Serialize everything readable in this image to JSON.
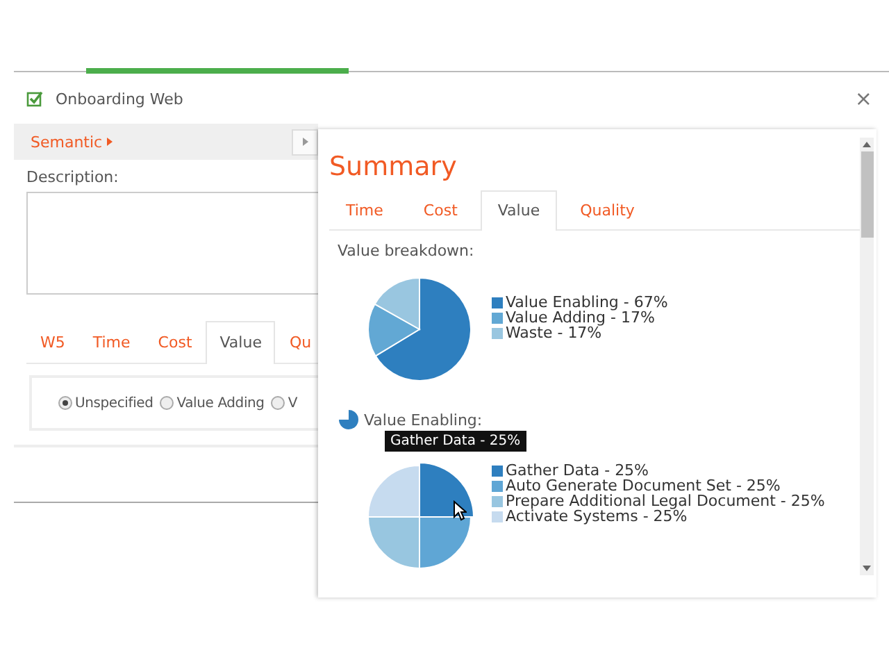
{
  "indicator": {
    "on": true
  },
  "header": {
    "title": "Onboarding Web",
    "checked": true,
    "close": "×"
  },
  "semantic": {
    "label": "Semantic"
  },
  "description": {
    "label": "Description:"
  },
  "tabs": [
    {
      "label": "W5",
      "selected": false
    },
    {
      "label": "Time",
      "selected": false
    },
    {
      "label": "Cost",
      "selected": false
    },
    {
      "label": "Value",
      "selected": true
    },
    {
      "label": "Qu",
      "selected": false
    }
  ],
  "value_options": [
    {
      "label": "Unspecified",
      "selected": true
    },
    {
      "label": "Value Adding",
      "selected": false
    },
    {
      "label": "V",
      "selected": false
    }
  ],
  "summary": {
    "title": "Summary",
    "tabs": [
      {
        "label": "Time",
        "selected": false
      },
      {
        "label": "Cost",
        "selected": false
      },
      {
        "label": "Value",
        "selected": true
      },
      {
        "label": "Quality",
        "selected": false
      }
    ],
    "sections": [
      {
        "label": "Value breakdown:",
        "chart_data": {
          "type": "pie",
          "categories": [
            "Value Enabling - 67%",
            "Value Adding - 17%",
            "Waste - 17%"
          ],
          "values": [
            67,
            17,
            17
          ],
          "legend": "right",
          "colors": [
            "#2e7fbf",
            "#62a8d4",
            "#99c6e0"
          ]
        }
      },
      {
        "label": "Value Enabling:",
        "tooltip": "Gather Data - 25%",
        "chart_data": {
          "type": "pie",
          "categories": [
            "Gather Data - 25%",
            "Auto Generate Document Set - 25%",
            "Prepare Additional Legal Document - 25%",
            "Activate Systems - 25%"
          ],
          "values": [
            25,
            25,
            25,
            25
          ],
          "legend": "right",
          "colors": [
            "#2e7fbf",
            "#5fa6d5",
            "#98c6e0",
            "#c6dbef"
          ]
        }
      }
    ]
  }
}
